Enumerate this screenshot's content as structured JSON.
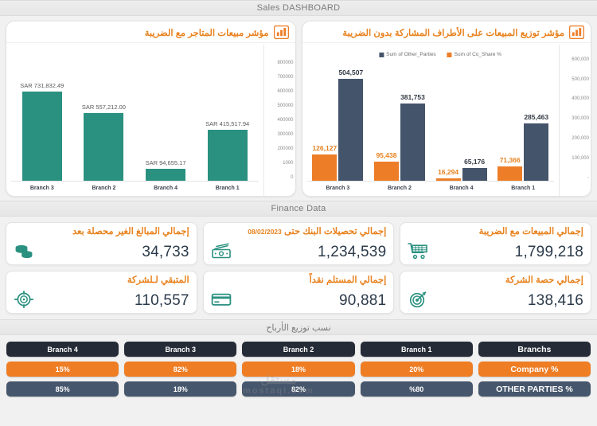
{
  "sections": {
    "sales_title": "Sales DASHBOARD",
    "finance_title": "Finance Data",
    "profit_title": "نسب توزيع الأرباح"
  },
  "colors": {
    "orange": "#ed7d27",
    "dark_blue": "#44546a",
    "teal": "#2a9180",
    "header_dark": "#252c37",
    "slate": "#46566c"
  },
  "chart_data": [
    {
      "type": "bar",
      "title": "مؤشر توزيع المبيعات على الأطراف المشاركة بدون الضريبة",
      "icon": "bar-chart-icon",
      "categories": [
        "Branch 3",
        "Branch 2",
        "Branch 4",
        "Branch 1"
      ],
      "legend": [
        {
          "name": "Sum of Other_Parties",
          "color": "#44546a"
        },
        {
          "name": "Sum of Co_Share %",
          "color": "#ed7d27"
        }
      ],
      "legend_position": "top-center",
      "series": [
        {
          "name": "Sum of Co_Share %",
          "color": "#ed7d27",
          "values": [
            126127,
            95438,
            16294,
            71366
          ],
          "labels": [
            "126,127",
            "95,438",
            "16,294",
            "71,366"
          ]
        },
        {
          "name": "Sum of Other_Parties",
          "color": "#44546a",
          "values": [
            504507,
            381753,
            65176,
            285463
          ],
          "labels": [
            "504,507",
            "381,753",
            "65,176",
            "285,463"
          ]
        }
      ],
      "ylim": [
        0,
        600000
      ],
      "yticks": [
        "600,000",
        "500,000",
        "400,000",
        "300,000",
        "200,000",
        "100,000",
        "-"
      ],
      "xlabel": "",
      "ylabel": "",
      "grid": false
    },
    {
      "type": "bar",
      "title": "مؤشر مبيعات المتاجر مع الضريبة",
      "icon": "bar-chart-icon",
      "categories": [
        "Branch 3",
        "Branch 2",
        "Branch 4",
        "Branch 1"
      ],
      "legend": [],
      "series": [
        {
          "name": "Sales with VAT",
          "color": "#2a9180",
          "values": [
            731832.49,
            557212.0,
            94655.17,
            415517.94
          ],
          "labels": [
            "SAR 731,832.49",
            "SAR 557,212.00",
            "SAR 94,655.17",
            "SAR 415,517.94"
          ]
        }
      ],
      "ylim": [
        0,
        800000
      ],
      "yticks": [
        "800000",
        "700000",
        "600000",
        "500000",
        "400000",
        "300000",
        "200000",
        "1000",
        "0"
      ],
      "xlabel": "",
      "ylabel": "",
      "grid": false
    }
  ],
  "finance": {
    "cards": [
      {
        "label": "إجمالي المبيعات مع الضريبة",
        "value": "1,799,218",
        "icon": "shopping-cart-icon",
        "date": ""
      },
      {
        "label": "إجمالي تحصيلات البنك حتى ",
        "date": "08/02/2023",
        "value": "1,234,539",
        "icon": "banknotes-icon"
      },
      {
        "label": "إجمالي المبالغ الغير محصلة بعد",
        "value": "34,733",
        "icon": "coins-icon",
        "date": ""
      },
      {
        "label": "إجمالي حصة الشركة",
        "value": "138,416",
        "icon": "target-arrow-icon",
        "date": ""
      },
      {
        "label": "إجمالي المستلم نقداً",
        "value": "90,881",
        "icon": "credit-card-icon",
        "date": ""
      },
      {
        "label": "المتبقي لـلشركة",
        "value": "110,557",
        "icon": "crosshair-icon",
        "date": ""
      }
    ]
  },
  "profit": {
    "columns": [
      {
        "head": "Branch 4",
        "company": "15%",
        "other": "85%"
      },
      {
        "head": "Branch 3",
        "company": "82%",
        "other": "18%"
      },
      {
        "head": "Branch 2",
        "company": "18%",
        "other": "82%"
      },
      {
        "head": "Branch 1",
        "company": "20%",
        "other": "%80"
      },
      {
        "head": "Branchs",
        "company": "Company  %",
        "other": "OTHER PARTIES  %"
      }
    ]
  },
  "watermark": {
    "line1": "مستقل",
    "line2": "mostaql.com"
  }
}
